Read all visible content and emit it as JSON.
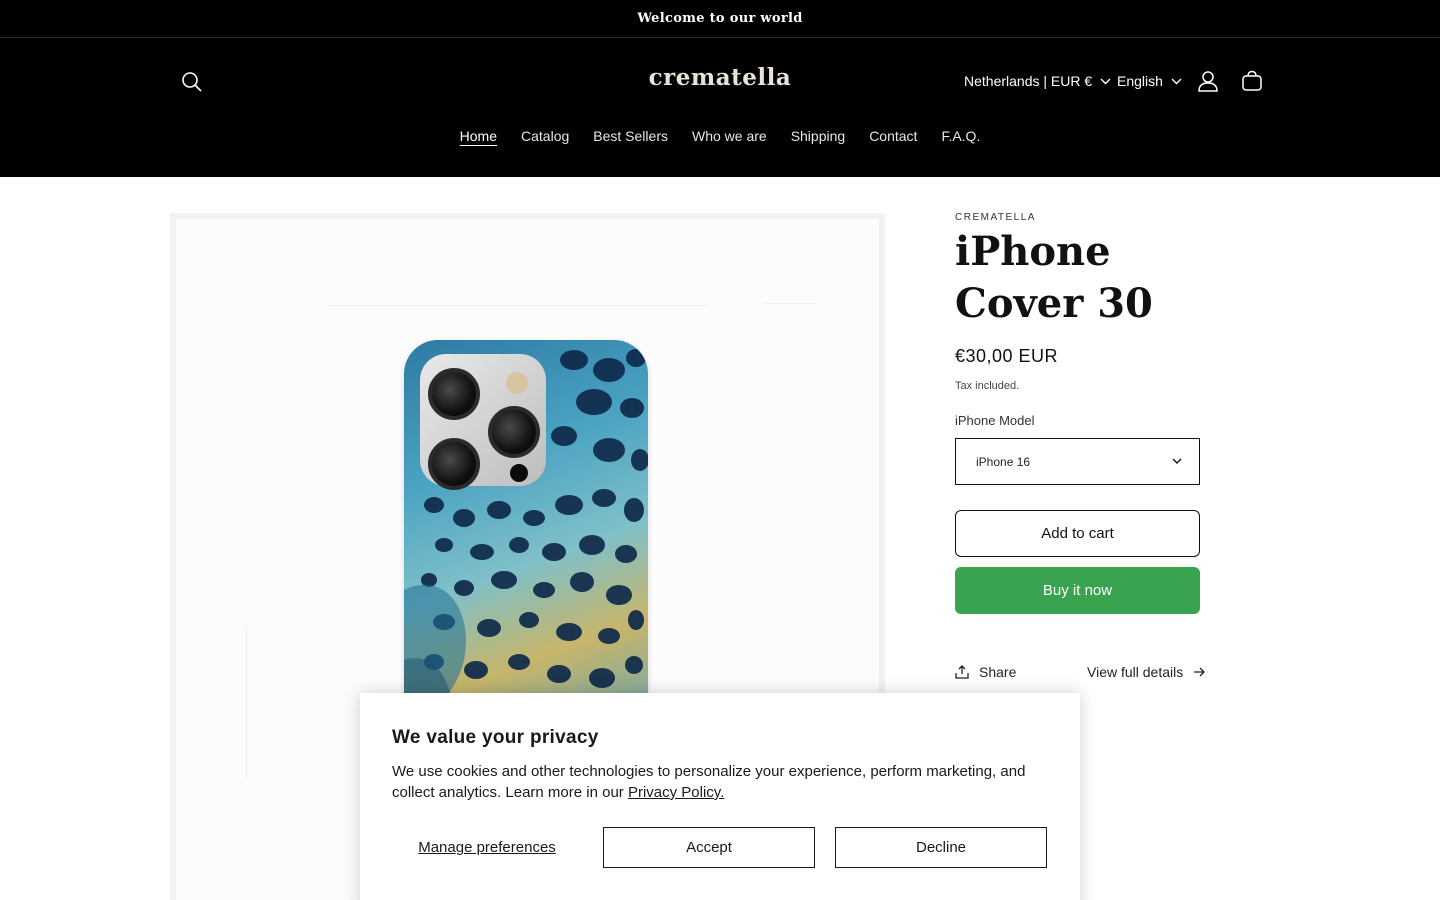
{
  "announcement": {
    "text": "Welcome to our world"
  },
  "header": {
    "logo": "crematella",
    "country_selector": "Netherlands | EUR €",
    "language_selector": "English",
    "icons": [
      "search-icon",
      "account-icon",
      "cart-icon"
    ]
  },
  "nav": {
    "items": [
      {
        "label": "Home",
        "active": true
      },
      {
        "label": "Catalog"
      },
      {
        "label": "Best Sellers"
      },
      {
        "label": "Who we are"
      },
      {
        "label": "Shipping"
      },
      {
        "label": "Contact"
      },
      {
        "label": "F.A.Q."
      }
    ]
  },
  "product": {
    "vendor": "CREMATELLA",
    "title": "iPhone Cover 30",
    "price": "€30,00 EUR",
    "tax_note": "Tax included.",
    "option_label": "iPhone Model",
    "option_value": "iPhone 16",
    "add_to_cart": "Add to cart",
    "buy_now": "Buy it now",
    "share": "Share",
    "view_full_details": "View full details"
  },
  "cookie_banner": {
    "title": "We value your privacy",
    "text": "We use cookies and other technologies to personalize your experience, perform marketing, and collect analytics. Learn more in our ",
    "link": "Privacy Policy.",
    "manage": "Manage preferences",
    "accept": "Accept",
    "decline": "Decline"
  },
  "colors": {
    "header_bg": "#000000",
    "buy_now_bg": "#3aa34f",
    "logo": "#e8e2d8"
  }
}
